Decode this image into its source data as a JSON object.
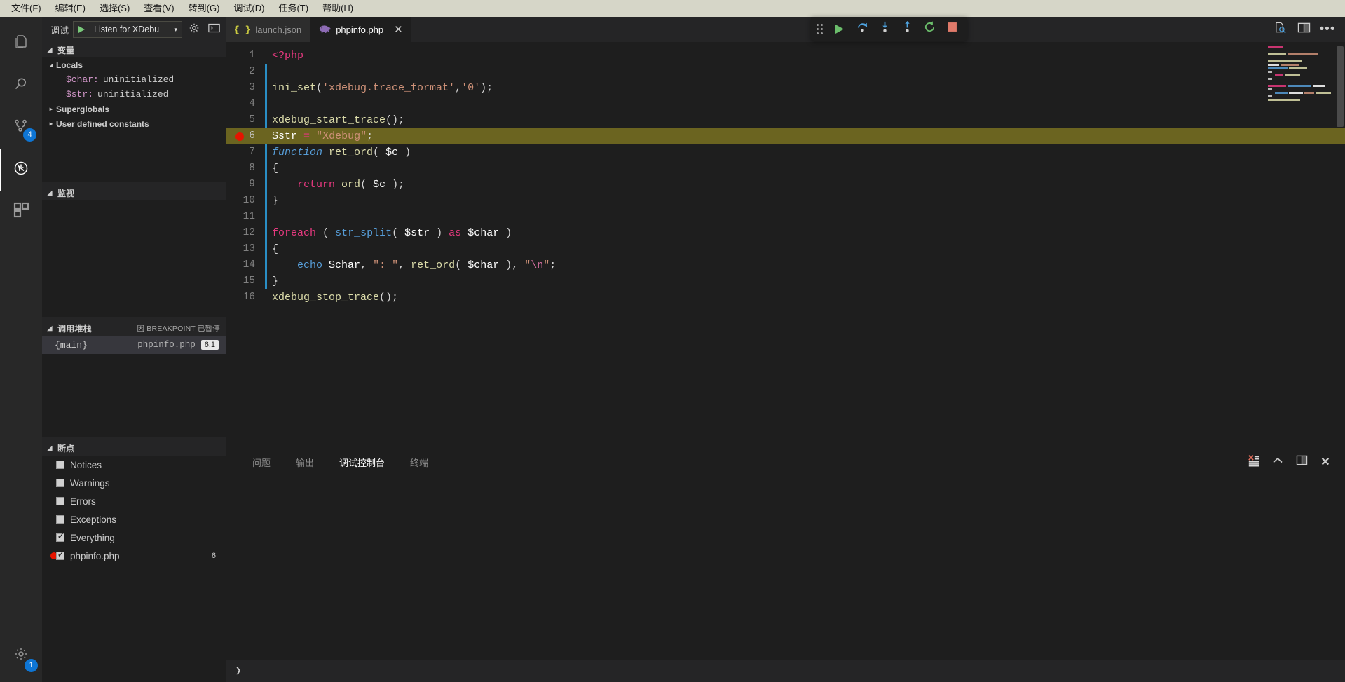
{
  "menubar": {
    "items": [
      {
        "label": "文件(F)",
        "name": "menu-file"
      },
      {
        "label": "编辑(E)",
        "name": "menu-edit"
      },
      {
        "label": "选择(S)",
        "name": "menu-selection"
      },
      {
        "label": "查看(V)",
        "name": "menu-view"
      },
      {
        "label": "转到(G)",
        "name": "menu-goto"
      },
      {
        "label": "调试(D)",
        "name": "menu-debug"
      },
      {
        "label": "任务(T)",
        "name": "menu-tasks"
      },
      {
        "label": "帮助(H)",
        "name": "menu-help"
      }
    ]
  },
  "activitybar": {
    "items": [
      {
        "icon": "files-explorer-icon",
        "active": false,
        "badge": ""
      },
      {
        "icon": "search-icon",
        "active": false,
        "badge": ""
      },
      {
        "icon": "source-control-icon",
        "active": false,
        "badge": "4"
      },
      {
        "icon": "run-and-debug-icon",
        "active": true,
        "badge": ""
      },
      {
        "icon": "extensions-icon",
        "active": false,
        "badge": ""
      }
    ],
    "manage": {
      "icon": "gear-icon",
      "badge": "1"
    }
  },
  "sidebar": {
    "debug_label": "调试",
    "launch_config": "Listen for XDebu",
    "caret": "▾",
    "play_title": "start-debugging",
    "gear_title": "open-launch-json",
    "console_title": "debug-console",
    "sections": {
      "variables": {
        "title": "变量",
        "groups": [
          {
            "label": "Locals",
            "expanded": true,
            "vars": [
              {
                "name": "$char:",
                "value": "uninitialized"
              },
              {
                "name": "$str:",
                "value": "uninitialized"
              }
            ]
          },
          {
            "label": "Superglobals",
            "expanded": false,
            "vars": []
          },
          {
            "label": "User defined constants",
            "expanded": false,
            "vars": []
          }
        ]
      },
      "watch": {
        "title": "监视",
        "items": []
      },
      "callstack": {
        "title": "调用堆栈",
        "reason": "因 BREAKPOINT 已暂停",
        "rows": [
          {
            "frame": "{main}",
            "file": "phpinfo.php",
            "pos": "6:1"
          }
        ]
      },
      "breakpoints": {
        "title": "断点",
        "rows": [
          {
            "label": "Notices",
            "checked": false,
            "dot": false,
            "count": ""
          },
          {
            "label": "Warnings",
            "checked": false,
            "dot": false,
            "count": ""
          },
          {
            "label": "Errors",
            "checked": false,
            "dot": false,
            "count": ""
          },
          {
            "label": "Exceptions",
            "checked": false,
            "dot": false,
            "count": ""
          },
          {
            "label": "Everything",
            "checked": true,
            "dot": false,
            "count": ""
          },
          {
            "label": "phpinfo.php",
            "checked": true,
            "dot": true,
            "count": "6"
          }
        ]
      }
    }
  },
  "tabs": [
    {
      "label": "launch.json",
      "icon": "json-braces-icon",
      "active": false,
      "closable": false
    },
    {
      "label": "phpinfo.php",
      "icon": "php-elephant-icon",
      "active": true,
      "closable": true,
      "close": "✕"
    }
  ],
  "debug_toolbar": {
    "buttons": [
      {
        "name": "drag-handle",
        "icon": "grip-icon"
      },
      {
        "name": "continue-button",
        "icon": "play-icon"
      },
      {
        "name": "step-over-button",
        "icon": "step-over-icon"
      },
      {
        "name": "step-into-button",
        "icon": "step-into-icon"
      },
      {
        "name": "step-out-button",
        "icon": "step-out-icon"
      },
      {
        "name": "restart-button",
        "icon": "restart-icon"
      },
      {
        "name": "stop-button",
        "icon": "stop-icon"
      }
    ]
  },
  "editor_actions": [
    {
      "name": "open-preview-button",
      "icon": "file-search-icon"
    },
    {
      "name": "split-editor-button",
      "icon": "split-editor-icon"
    },
    {
      "name": "more-actions-button",
      "icon": "ellipsis-icon"
    }
  ],
  "code": {
    "current_line": 6,
    "breakpoint_line": 6,
    "lines": [
      {
        "n": 1,
        "html": "<span class=\"t-tag\">&lt;?php</span>"
      },
      {
        "n": 2,
        "html": ""
      },
      {
        "n": 3,
        "html": "<span class=\"t-fn\">ini_set</span><span class=\"t-punct\">(</span><span class=\"t-str\">'xdebug.trace_format'</span><span class=\"t-punct\">,</span><span class=\"t-str\">'0'</span><span class=\"t-punct\">);</span>"
      },
      {
        "n": 4,
        "html": ""
      },
      {
        "n": 5,
        "html": "<span class=\"t-fn\">xdebug_start_trace</span><span class=\"t-punct\">();</span>"
      },
      {
        "n": 6,
        "html": "<span class=\"t-var\">$str</span> <span class=\"t-op\">=</span> <span class=\"t-str\">\"Xdebug\"</span><span class=\"t-punct\">;</span>"
      },
      {
        "n": 7,
        "html": "<span class=\"t-kw2\" style=\"font-style:italic\">function</span> <span class=\"t-fn\">ret_ord</span><span class=\"t-punct\">(</span> <span class=\"t-var\">$c</span> <span class=\"t-punct\">)</span>"
      },
      {
        "n": 8,
        "html": "<span class=\"t-punct\">{</span>"
      },
      {
        "n": 9,
        "html": "    <span class=\"t-kw\">return</span> <span class=\"t-fn\">ord</span><span class=\"t-punct\">(</span> <span class=\"t-var\">$c</span> <span class=\"t-punct\">);</span>"
      },
      {
        "n": 10,
        "html": "<span class=\"t-punct\">}</span>"
      },
      {
        "n": 11,
        "html": ""
      },
      {
        "n": 12,
        "html": "<span class=\"t-kw\">foreach</span> <span class=\"t-punct\">(</span> <span class=\"t-kw2\">str_split</span><span class=\"t-punct\">(</span> <span class=\"t-var\">$str</span> <span class=\"t-punct\">)</span> <span class=\"t-kw\">as</span> <span class=\"t-var\">$char</span> <span class=\"t-punct\">)</span>"
      },
      {
        "n": 13,
        "html": "<span class=\"t-punct\">{</span>"
      },
      {
        "n": 14,
        "html": "    <span class=\"t-kw2\">echo</span> <span class=\"t-var\">$char</span><span class=\"t-punct\">,</span> <span class=\"t-str\">\": \"</span><span class=\"t-punct\">,</span> <span class=\"t-fn\">ret_ord</span><span class=\"t-punct\">(</span> <span class=\"t-var\">$char</span> <span class=\"t-punct\">),</span> <span class=\"t-str\">\"</span><span class=\"t-magenta\">\\n</span><span class=\"t-str\">\"</span><span class=\"t-punct\">;</span>"
      },
      {
        "n": 15,
        "html": "<span class=\"t-punct\">}</span>"
      },
      {
        "n": 16,
        "html": "<span class=\"t-fn\">xdebug_stop_trace</span><span class=\"t-punct\">();</span>"
      }
    ]
  },
  "panel": {
    "tabs": [
      {
        "label": "问题",
        "active": false
      },
      {
        "label": "输出",
        "active": false
      },
      {
        "label": "调试控制台",
        "active": true
      },
      {
        "label": "终端",
        "active": false
      }
    ],
    "actions": [
      {
        "name": "clear-console-button",
        "icon": "clear-console-icon"
      },
      {
        "name": "maximize-panel-button",
        "icon": "chevron-up-icon"
      },
      {
        "name": "split-panel-button",
        "icon": "split-panel-icon"
      },
      {
        "name": "close-panel-button",
        "icon": "close-icon"
      }
    ],
    "console_output": "",
    "input_prompt": "❯",
    "input_value": ""
  },
  "colors": {
    "accent": "#0e75d4",
    "breakpoint": "#e51400",
    "highlight_line": "#6b6420",
    "menubar_bg": "#d6d6c8",
    "editor_bg": "#1e1e1e",
    "sidebar_bg": "#252526"
  }
}
